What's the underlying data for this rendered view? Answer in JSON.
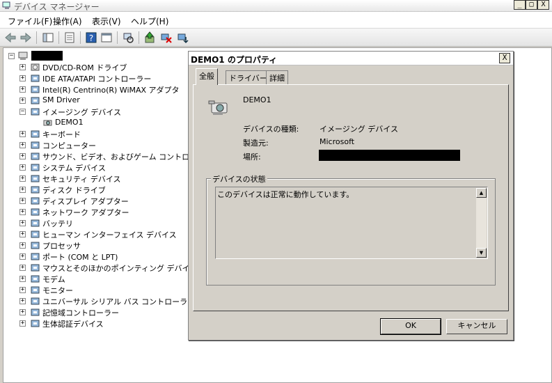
{
  "window": {
    "title": "デバイス マネージャー",
    "buttons": {
      "minimize": "_",
      "maximize": "□",
      "close": "X"
    }
  },
  "menubar": [
    "ファイル(F)",
    "操作(A)",
    "表示(V)",
    "ヘルプ(H)"
  ],
  "toolbar": [
    "back-icon",
    "forward-icon",
    "show-hide-console-tree-icon",
    "properties-icon",
    "help-icon",
    "view-icon",
    "scan-hardware-icon",
    "update-driver-icon",
    "disable-device-icon",
    "uninstall-device-icon"
  ],
  "tree": {
    "root": "",
    "items": [
      {
        "label": "DVD/CD-ROM ドライブ",
        "icon": "dvd-icon"
      },
      {
        "label": "IDE ATA/ATAPI コントローラー",
        "icon": "ide-controller-icon"
      },
      {
        "label": "Intel(R) Centrino(R) WiMAX アダプタ",
        "icon": "wimax-icon"
      },
      {
        "label": "SM Driver",
        "icon": "sm-driver-icon"
      },
      {
        "label": "イメージング デバイス",
        "icon": "imaging-device-icon",
        "expanded": true
      },
      {
        "label": "DEMO1",
        "icon": "camera-icon",
        "child": true
      },
      {
        "label": "キーボード",
        "icon": "keyboard-icon"
      },
      {
        "label": "コンピューター",
        "icon": "computer-icon"
      },
      {
        "label": "サウンド、ビデオ、およびゲーム コントローラー",
        "icon": "sound-icon"
      },
      {
        "label": "システム デバイス",
        "icon": "system-device-icon"
      },
      {
        "label": "セキュリティ デバイス",
        "icon": "security-device-icon"
      },
      {
        "label": "ディスク ドライブ",
        "icon": "disk-drive-icon"
      },
      {
        "label": "ディスプレイ アダプター",
        "icon": "display-adapter-icon"
      },
      {
        "label": "ネットワーク アダプター",
        "icon": "network-adapter-icon"
      },
      {
        "label": "バッテリ",
        "icon": "battery-icon"
      },
      {
        "label": "ヒューマン インターフェイス デバイス",
        "icon": "hid-icon"
      },
      {
        "label": "プロセッサ",
        "icon": "processor-icon"
      },
      {
        "label": "ポート (COM と LPT)",
        "icon": "port-icon"
      },
      {
        "label": "マウスとそのほかのポインティング デバイス",
        "icon": "mouse-icon"
      },
      {
        "label": "モデム",
        "icon": "modem-icon"
      },
      {
        "label": "モニター",
        "icon": "monitor-icon"
      },
      {
        "label": "ユニバーサル シリアル バス コントローラー",
        "icon": "usb-icon"
      },
      {
        "label": "記憶域コントローラー",
        "icon": "storage-controller-icon"
      },
      {
        "label": "生体認証デバイス",
        "icon": "biometric-icon"
      }
    ]
  },
  "dialog": {
    "title": "DEMO1 のプロパティ",
    "close": "X",
    "tabs": [
      "全般",
      "ドライバー",
      "詳細"
    ],
    "device_name": "DEMO1",
    "props": {
      "type_label": "デバイスの種類:",
      "type_value": "イメージング デバイス",
      "mfr_label": "製造元:",
      "mfr_value": "Microsoft",
      "location_label": "場所:",
      "location_value": ""
    },
    "status_group_label": "デバイスの状態",
    "status_text": "このデバイスは正常に動作しています。",
    "ok_label": "OK",
    "cancel_label": "キャンセル"
  }
}
